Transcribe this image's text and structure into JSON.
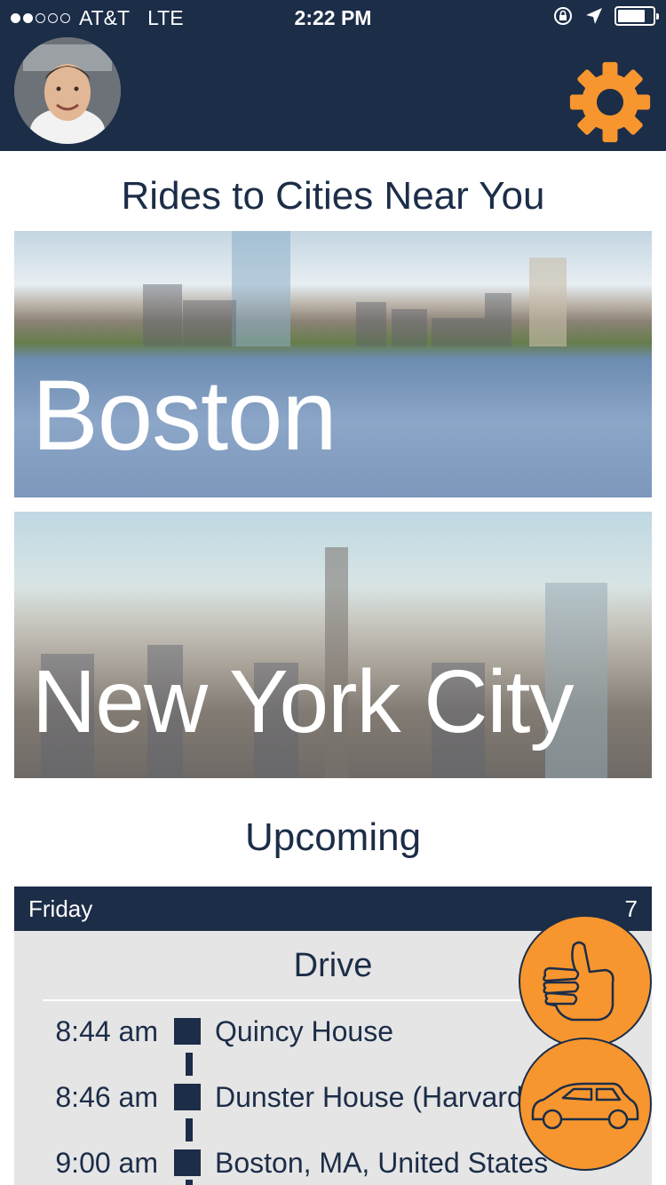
{
  "status_bar": {
    "carrier": "AT&T",
    "network": "LTE",
    "time": "2:22 PM"
  },
  "header": {
    "avatar_icon": "profile-photo",
    "settings_icon": "gear-icon",
    "accent_color": "#f7962e",
    "bar_color": "#1c2d48"
  },
  "rides_section": {
    "title": "Rides to Cities Near You",
    "cities": [
      {
        "name": "Boston"
      },
      {
        "name": "New York City"
      }
    ]
  },
  "upcoming_section": {
    "title": "Upcoming",
    "day": "Friday",
    "day_trailing": "7",
    "drive_title": "Drive",
    "stops": [
      {
        "time": "8:44 am",
        "place": "Quincy House"
      },
      {
        "time": "8:46 am",
        "place": "Dunster House (Harvard"
      },
      {
        "time": "9:00 am",
        "place": "Boston, MA, United States"
      }
    ]
  },
  "actions": {
    "hitch_icon": "thumbs-up-icon",
    "drive_icon": "car-icon"
  }
}
